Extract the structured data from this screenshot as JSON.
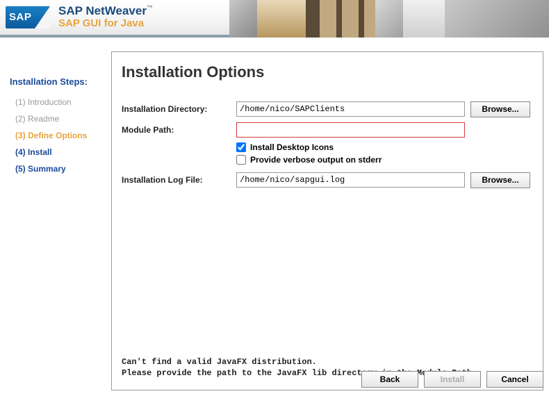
{
  "branding": {
    "logo_text": "SAP",
    "title_line1": "SAP NetWeaver",
    "title_line2": "SAP GUI for Java"
  },
  "sidebar": {
    "heading": "Installation Steps:",
    "steps": [
      {
        "label": "(1) Introduction",
        "state": "done"
      },
      {
        "label": "(2) Readme",
        "state": "done"
      },
      {
        "label": "(3) Define Options",
        "state": "current"
      },
      {
        "label": "(4) Install",
        "state": "future"
      },
      {
        "label": "(5) Summary",
        "state": "future"
      }
    ]
  },
  "main": {
    "title": "Installation Options",
    "fields": {
      "install_dir_label": "Installation Directory:",
      "install_dir_value": "/home/nico/SAPClients",
      "module_path_label": "Module Path:",
      "module_path_value": "",
      "log_file_label": "Installation Log File:",
      "log_file_value": "/home/nico/sapgui.log",
      "browse_label": "Browse..."
    },
    "checks": {
      "desktop_icons_label": "Install Desktop Icons",
      "desktop_icons_checked": true,
      "verbose_label": "Provide verbose output on stderr",
      "verbose_checked": false
    },
    "error_line1": "Can't find a valid JavaFX distribution.",
    "error_line2": "Please provide the path to the JavaFX lib directory in the Module Path"
  },
  "buttons": {
    "back": "Back",
    "install": "Install",
    "cancel": "Cancel",
    "install_enabled": false
  }
}
